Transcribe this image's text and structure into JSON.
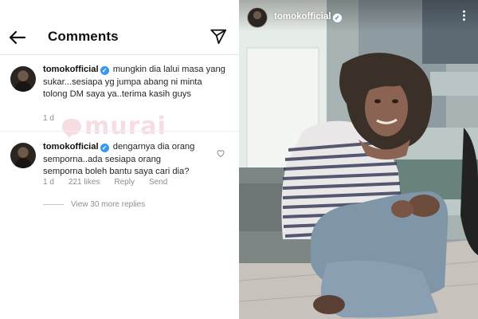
{
  "header": {
    "title": "Comments"
  },
  "comments": [
    {
      "username": "tomokofficial",
      "text": "mungkin dia lalui masa yang sukar...sesiapa yg jumpa abang ni minta tolong DM saya ya..terima kasih guys",
      "time": "1 d"
    },
    {
      "username": "tomokofficial",
      "text": "dengarnya dia orang semporna..ada sesiapa orang semporna boleh bantu saya cari dia?",
      "time": "1 d",
      "likes": "221 likes",
      "reply_label": "Reply",
      "send_label": "Send",
      "view_more": "View 30 more replies"
    }
  ],
  "watermark": {
    "text": "murai"
  },
  "post": {
    "username": "tomokofficial"
  },
  "icons": {
    "back": "back-arrow-icon",
    "share": "paper-plane-icon",
    "verified": "verified-badge-icon",
    "heart": "heart-outline-icon",
    "more": "more-vertical-icon"
  },
  "colors": {
    "verified": "#3897f0",
    "muted_text": "#8e8e8e",
    "watermark": "#d36a80"
  }
}
